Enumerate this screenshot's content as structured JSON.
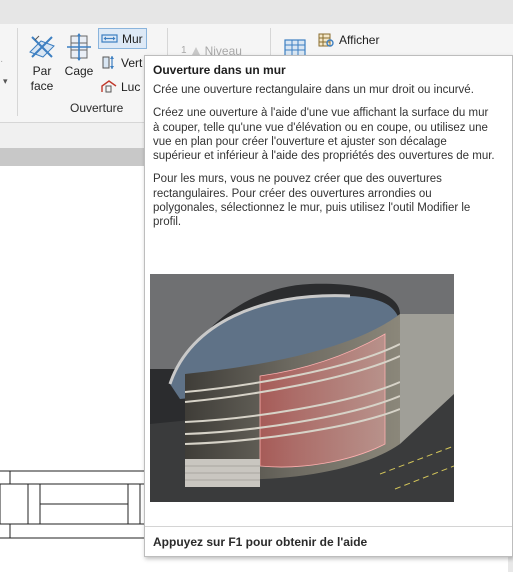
{
  "ribbon": {
    "buttons": {
      "par_face": "Par\nface",
      "cage": "Cage",
      "mur": "Mur",
      "vertical": "Vert",
      "lucarne": "Luc",
      "niveau": "Niveau",
      "afficher": "Afficher"
    },
    "level_prefix": "1",
    "panel_label": "Ouverture",
    "collapse_arrow": "▾"
  },
  "tooltip": {
    "title": "Ouverture dans un mur",
    "paragraphs": [
      "Crée une ouverture rectangulaire dans un mur droit ou incurvé.",
      "Créez une ouverture à l'aide d'une vue affichant la surface du mur à couper, telle qu'une vue d'élévation ou en coupe, ou utilisez une vue en plan pour créer l'ouverture et ajuster son décalage supérieur et inférieur à l'aide des propriétés des ouvertures de mur.",
      "Pour les murs, vous ne pouvez créer que des ouvertures rectangulaires. Pour créer des ouvertures arrondies ou polygonales, sélectionnez le mur, puis utilisez l'outil Modifier le profil."
    ],
    "help": "Appuyez sur F1 pour obtenir de l'aide"
  },
  "colors": {
    "active_bg": "#dde9f6",
    "active_border": "#8ab4dc",
    "icon_blue": "#3d7fc1",
    "opening_red": "#e05a5a"
  },
  "icons": [
    "par-face-icon",
    "cage-icon",
    "mur-icon",
    "vertical-icon",
    "lucarne-icon",
    "niveau-icon",
    "afficher-icon",
    "grid-icon"
  ]
}
